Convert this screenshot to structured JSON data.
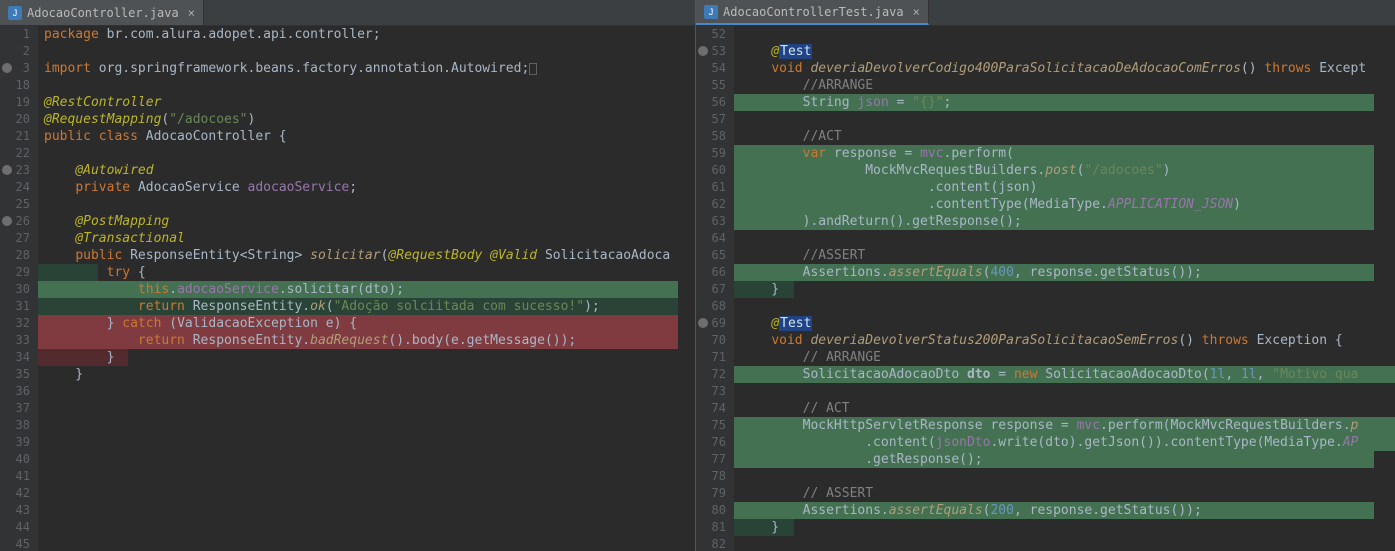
{
  "left": {
    "tab": {
      "label": "AdocaoController.java",
      "close": "×"
    },
    "lines": [
      {
        "n": "1",
        "html": "<span class='kw'>package</span> <span class='pkg'>br.com.alura.adopet.api.controller</span>;"
      },
      {
        "n": "2",
        "html": ""
      },
      {
        "n": "3",
        "ann": "dot",
        "html": "<span class='kw'>import</span> <span class='pkg'>org.springframework.beans.factory.annotation.Autowired</span>;<span class='caret-box'></span>"
      },
      {
        "n": "18",
        "html": ""
      },
      {
        "n": "19",
        "html": "<span class='ann-kw'>@RestController</span>"
      },
      {
        "n": "20",
        "html": "<span class='ann-kw'>@RequestMapping</span>(<span class='str'>\"/adocoes\"</span>)"
      },
      {
        "n": "21",
        "html": "<span class='kw'>public class</span> <span class='cls'>AdocaoController</span> {"
      },
      {
        "n": "22",
        "html": ""
      },
      {
        "n": "23",
        "ann": "dot",
        "html": "    <span class='ann-kw'>@Autowired</span>"
      },
      {
        "n": "24",
        "html": "    <span class='kw'>private</span> <span class='cls'>AdocaoService</span> <span class='fld'>adocaoService</span>;"
      },
      {
        "n": "25",
        "html": ""
      },
      {
        "n": "26",
        "ann": "dot",
        "html": "    <span class='ann-kw'>@PostMapping</span>"
      },
      {
        "n": "27",
        "html": "    <span class='ann-kw'>@Transactional</span>"
      },
      {
        "n": "28",
        "html": "    <span class='kw'>public</span> <span class='cls'>ResponseEntity</span>&lt;<span class='cls'>String</span>&gt; <span class='mth'>solicitar</span>(<span class='ann-kw'>@RequestBody</span> <span class='ann-kw'>@Valid</span> <span class='cls'>SolicitacaoAdoca</span>"
      },
      {
        "n": "29",
        "hl": "green",
        "hlw": "60",
        "html": "        <span class='kw'>try</span> {"
      },
      {
        "n": "30",
        "hl": "greenL",
        "hlw": "640",
        "html": "            <span class='kw'>this</span>.<span class='fld'>adocaoService</span>.<span class='call'>solicitar</span>(dto);"
      },
      {
        "n": "31",
        "hl": "green",
        "hlw": "640",
        "html": "            <span class='kw'>return</span> <span class='cls'>ResponseEntity</span>.<span class='smth'>ok</span>(<span class='str'>\"Adoção solciitada com sucesso!\"</span>);"
      },
      {
        "n": "32",
        "hl": "redL",
        "hlw": "640",
        "html": "        } <span class='kw'>catch</span> (<span class='cls'>ValidacaoException</span> e) {"
      },
      {
        "n": "33",
        "hl": "redL",
        "hlw": "640",
        "html": "            <span class='kw'>return</span> <span class='cls'>ResponseEntity</span>.<span class='smth'>badRequest</span>().body(e.getMessage());"
      },
      {
        "n": "34",
        "hl": "red",
        "hlw": "90",
        "html": "        }"
      },
      {
        "n": "35",
        "html": "    }"
      },
      {
        "n": "36",
        "html": ""
      },
      {
        "n": "37",
        "html": ""
      },
      {
        "n": "38",
        "html": ""
      },
      {
        "n": "39",
        "html": ""
      },
      {
        "n": "40",
        "html": ""
      },
      {
        "n": "41",
        "html": ""
      },
      {
        "n": "42",
        "html": ""
      },
      {
        "n": "43",
        "html": ""
      },
      {
        "n": "44",
        "html": ""
      },
      {
        "n": "45",
        "html": ""
      }
    ]
  },
  "right": {
    "tab": {
      "label": "AdocaoControllerTest.java",
      "close": "×"
    },
    "lines": [
      {
        "n": "52",
        "html": ""
      },
      {
        "n": "53",
        "ann": "dot",
        "html": "    <span class='ann-kw'>@</span><span class='ann-hi'>Test</span>"
      },
      {
        "n": "54",
        "html": "    <span class='kw'>void</span> <span class='mth'>deveriaDevolverCodigo400ParaSolicitacaoDeAdocaoComErros</span>() <span class='kw'>throws</span> <span class='cls'>Except</span>"
      },
      {
        "n": "55",
        "html": "        <span class='cmt'>//ARRANGE</span>"
      },
      {
        "n": "56",
        "hl": "greenL",
        "hlw": "640",
        "html": "        <span class='cls'>String</span> <span class='fld'>json</span> = <span class='str'>\"{}\"</span>;"
      },
      {
        "n": "57",
        "html": ""
      },
      {
        "n": "58",
        "html": "        <span class='cmt'>//ACT</span>"
      },
      {
        "n": "59",
        "hl": "greenL",
        "hlw": "640",
        "html": "        <span class='kw'>var</span> response = <span class='fld'>mvc</span>.perform("
      },
      {
        "n": "60",
        "hl": "greenL",
        "hlw": "640",
        "html": "                <span class='cls'>MockMvcRequestBuilders</span>.<span class='smth'>post</span>(<span class='str'>\"/adocoes\"</span>)"
      },
      {
        "n": "61",
        "hl": "greenL",
        "hlw": "640",
        "html": "                        .content(json)"
      },
      {
        "n": "62",
        "hl": "greenL",
        "hlw": "640",
        "html": "                        .contentType(<span class='cls'>MediaType</span>.<span class='fld' style='font-style:italic'>APPLICATION_JSON</span>)"
      },
      {
        "n": "63",
        "hl": "greenL",
        "hlw": "640",
        "html": "        ).andReturn().getResponse();"
      },
      {
        "n": "64",
        "html": ""
      },
      {
        "n": "65",
        "html": "        <span class='cmt'>//ASSERT</span>"
      },
      {
        "n": "66",
        "hl": "greenL",
        "hlw": "640",
        "html": "        <span class='cls'>Assertions</span>.<span class='smth'>assertEquals</span>(<span class='num'>400</span>, response.getStatus());"
      },
      {
        "n": "67",
        "hl": "green",
        "hlw": "60",
        "html": "    }"
      },
      {
        "n": "68",
        "html": ""
      },
      {
        "n": "69",
        "ann": "dot",
        "html": "    <span class='ann-kw'>@</span><span class='ann-hi'>Test</span>"
      },
      {
        "n": "70",
        "html": "    <span class='kw'>void</span> <span class='mth'>deveriaDevolverStatus200ParaSolicitacaoSemErros</span>() <span class='kw'>throws</span> <span class='cls'>Exception</span> {"
      },
      {
        "n": "71",
        "html": "        <span class='cmt'>// ARRANGE</span>"
      },
      {
        "n": "72",
        "hl": "greenL",
        "hlw": "680",
        "html": "        <span class='cls'>SolicitacaoAdocaoDto</span> <span style='font-weight:bold'>dto</span> = <span class='kw'>new</span> <span class='cls'>SolicitacaoAdocaoDto</span>(<span class='num'>1l</span>, <span class='num'>1l</span>, <span class='str'>\"Motivo qua</span>"
      },
      {
        "n": "73",
        "html": ""
      },
      {
        "n": "74",
        "html": "        <span class='cmt'>// ACT</span>"
      },
      {
        "n": "75",
        "hl": "greenL",
        "hlw": "680",
        "html": "        <span class='cls'>MockHttpServletResponse</span> response = <span class='fld'>mvc</span>.perform(<span class='cls'>MockMvcRequestBuilders</span>.<span class='smth'>p</span>"
      },
      {
        "n": "76",
        "hl": "greenL",
        "hlw": "680",
        "html": "                .content(<span class='fld'>jsonDto</span>.write(dto).getJson()).contentType(<span class='cls'>MediaType</span>.<span class='fld' style='font-style:italic'>AP</span>"
      },
      {
        "n": "77",
        "hl": "greenL",
        "hlw": "640",
        "html": "                .getResponse();"
      },
      {
        "n": "78",
        "html": ""
      },
      {
        "n": "79",
        "html": "        <span class='cmt'>// ASSERT</span>"
      },
      {
        "n": "80",
        "hl": "greenL",
        "hlw": "640",
        "html": "        <span class='cls'>Assertions</span>.<span class='smth'>assertEquals</span>(<span class='num'>200</span>, response.getStatus());"
      },
      {
        "n": "81",
        "hl": "green",
        "hlw": "60",
        "html": "    }"
      },
      {
        "n": "82",
        "html": ""
      }
    ]
  }
}
